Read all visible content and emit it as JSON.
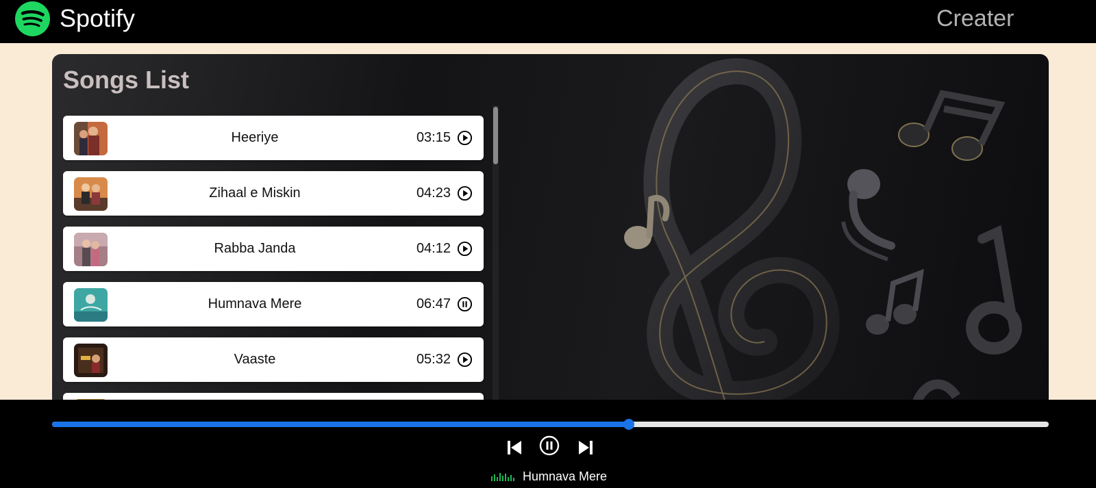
{
  "navbar": {
    "brand": "Spotify",
    "logo_icon": "spotify-logo-icon",
    "right_link": "Creater"
  },
  "songs_list": {
    "title": "Songs List",
    "items": [
      {
        "name": "Heeriye",
        "duration": "03:15",
        "state_icon": "play-circle-icon"
      },
      {
        "name": "Zihaal e Miskin",
        "duration": "04:23",
        "state_icon": "play-circle-icon"
      },
      {
        "name": "Rabba Janda",
        "duration": "04:12",
        "state_icon": "play-circle-icon"
      },
      {
        "name": "Humnava Mere",
        "duration": "06:47",
        "state_icon": "pause-circle-icon"
      },
      {
        "name": "Vaaste",
        "duration": "05:32",
        "state_icon": "play-circle-icon"
      }
    ]
  },
  "player": {
    "progress_fraction": 0.579,
    "controls": [
      "previous-icon",
      "pause-circle-icon",
      "next-icon"
    ],
    "now_playing": "Humnava Mere",
    "now_playing_icon": "equalizer-icon"
  },
  "colors": {
    "brand_green": "#1ed760",
    "accent_blue": "#1a73e8",
    "background": "#faebd7",
    "bar": "#000000"
  }
}
